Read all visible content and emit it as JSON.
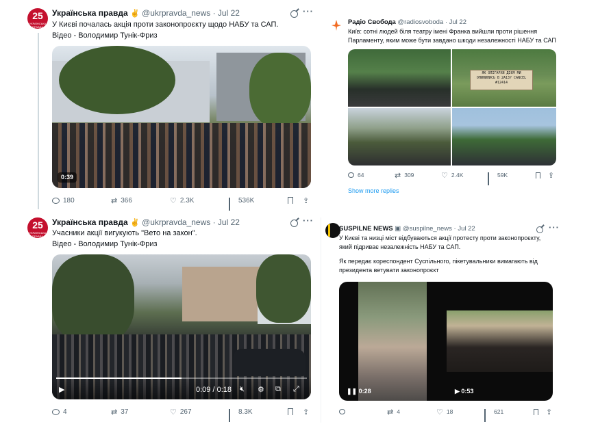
{
  "tweets": [
    {
      "avatar": {
        "text": "25",
        "subtext": "УКРАЇНСЬКА ПРАВДА"
      },
      "name": "Українська правда",
      "emoji": "✌",
      "handle": "@ukrpravda_news",
      "time": "· Jul 22",
      "text_line1": "У Києві почалась акція проти законопроєкту щодо НАБУ та САП.",
      "text_line2": "Відео - Володимир Тунік-Фриз",
      "video_duration": "0:39",
      "replies": "180",
      "retweets": "366",
      "likes": "2.3K",
      "views": "536K"
    },
    {
      "avatar": {
        "text": "25",
        "subtext": "УКРАЇНСЬКА ПРАВДА"
      },
      "name": "Українська правда",
      "emoji": "✌",
      "handle": "@ukrpravda_news",
      "time": "· Jul 22",
      "text_line1": "Учасники акції вигукують \"Вето на закон\".",
      "text_line2": "Відео - Володимир Тунік-Фриз",
      "video_time": "0:09 / 0:18",
      "video_progress": 0.5,
      "replies": "4",
      "retweets": "37",
      "likes": "267",
      "views": "8.3K"
    },
    {
      "name": "Радіо Свобода",
      "handle": "@radiosvoboda",
      "time": "· Jul 22",
      "text_line1": "Київ: сотні людей біля театру імені Франка вийшли проти рішення",
      "text_line2": "Парламенту, яким може бути завдано шкоди незалежності НАБУ та САП",
      "sign_text": "ЯК ОЛІГАРХИ ДІЄМ МИ ОПИНИЛИСЬ В 2А13? CANCEL #12414",
      "replies": "64",
      "retweets": "309",
      "likes": "2.4K",
      "views": "59K",
      "show_more": "Show more replies"
    },
    {
      "name": "SUSPILNE NEWS",
      "handle": "@suspilne_news",
      "time": "· Jul 22",
      "text_line1": "У Києві та низці міст відбуваються акції протесту проти законопроєкту,",
      "text_line2": "який підриває незалежність НАБУ та САП.",
      "text_line3": "Як передає кореспондент Суспільного, пікетувальники вимагають від",
      "text_line4": "президента ветувати законопроєкт",
      "video1_duration": "0:28",
      "video2_duration": "0:53",
      "replies": "",
      "retweets": "4",
      "likes": "18",
      "views": "621"
    }
  ],
  "icons": {
    "reply": "reply-icon",
    "retweet": "retweet-icon",
    "like": "heart-icon",
    "views": "views-icon",
    "bookmark": "bookmark-icon",
    "share": "share-icon",
    "grok": "grok-icon",
    "more": "more-icon"
  },
  "colors": {
    "up_brand": "#c4102e",
    "link": "#1d9bf0",
    "muted": "#536471",
    "suspilne_accent": "#f5c400"
  }
}
